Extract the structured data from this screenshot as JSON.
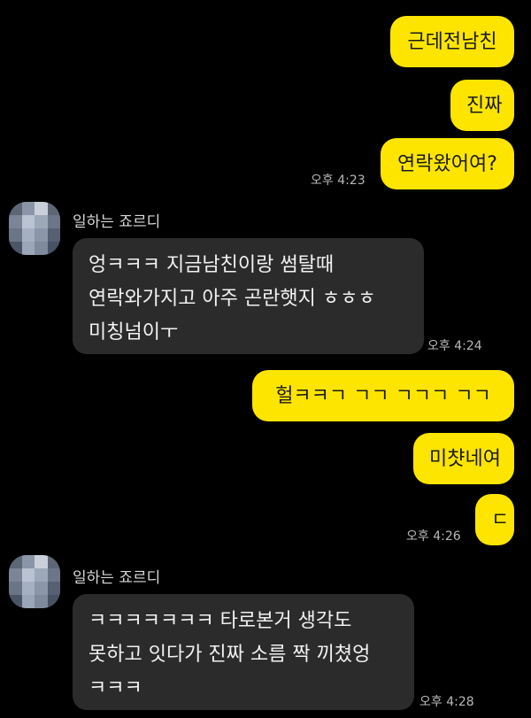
{
  "messages": [
    {
      "text": "근데전남친"
    },
    {
      "text": "진짜"
    },
    {
      "text": "연락왔어여?"
    },
    {
      "text": "오후 4:23"
    },
    {
      "text": "일하는 죠르디"
    },
    {
      "text": "엉ㅋㅋㅋ 지금남친이랑 썸탈때\n연락와가지고 아주 곤란햇지 ㅎㅎㅎ\n미칭넘이ㅜ"
    },
    {
      "text": "오후 4:24"
    },
    {
      "text": "헐ㅋㅋㄱ ㄱㄱ ㄱㄱㄱ ㄱㄱ"
    },
    {
      "text": "미챳네여"
    },
    {
      "text": "ㄷ"
    },
    {
      "text": "오후 4:26"
    },
    {
      "text": "일하는 죠르디"
    },
    {
      "text": "ㅋㅋㅋㅋㅋㅋㅋ 타로본거 생각도\n못하고 잇다가 진짜 소름 짝 끼쳤엉\nㅋㅋㅋ"
    },
    {
      "text": "오후 4:28"
    }
  ],
  "colors": {
    "background": "#000000",
    "outgoing_bubble": "#FEE500",
    "incoming_bubble": "#2b2b2b"
  },
  "icons": {
    "avatar": "pixelated-profile-avatar"
  }
}
